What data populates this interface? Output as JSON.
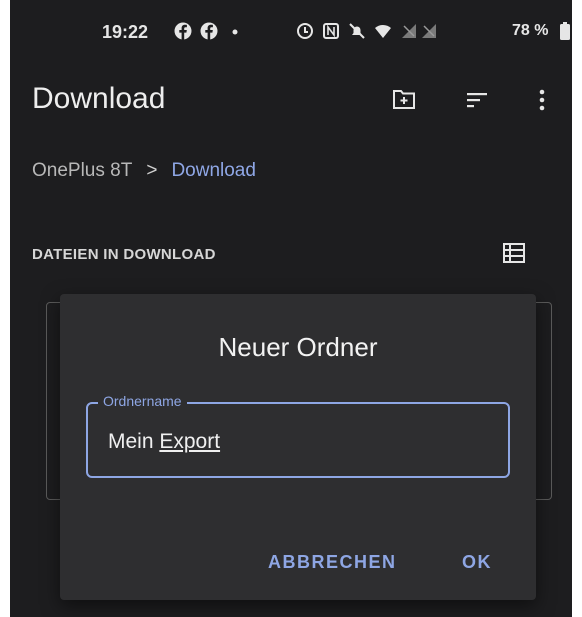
{
  "status_bar": {
    "time": "19:22",
    "icons": [
      "facebook-icon",
      "facebook-icon",
      "dot-icon",
      "data-saver-icon",
      "nfc-icon",
      "mute-icon",
      "wifi-icon",
      "no-signal-icon",
      "no-signal-icon",
      "battery-icon"
    ],
    "battery_percent": "78 %"
  },
  "app_bar": {
    "title": "Download",
    "actions": [
      "new-folder-icon",
      "sort-icon",
      "overflow-menu-icon"
    ]
  },
  "breadcrumb": {
    "root": "OnePlus 8T",
    "separator": ">",
    "current": "Download"
  },
  "section": {
    "header": "DATEIEN IN DOWNLOAD",
    "view_toggle_icon": "list-view-icon"
  },
  "dialog": {
    "title": "Neuer Ordner",
    "input_label": "Ordnername",
    "input_value_plain": "Mein ",
    "input_value_underlined": "Export",
    "cancel_label": "ABBRECHEN",
    "ok_label": "OK"
  },
  "colors": {
    "background": "#1d1d1f",
    "dialog": "#2e2e30",
    "accent": "#8ea6e4"
  }
}
